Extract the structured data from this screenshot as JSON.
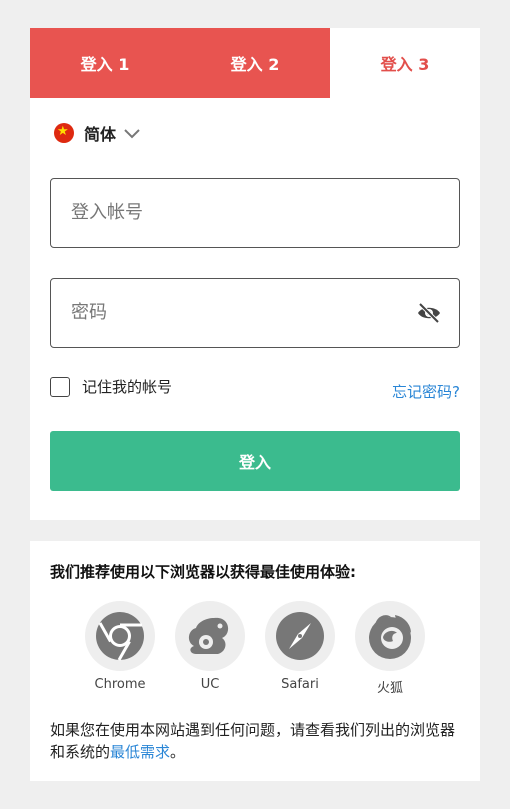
{
  "tabs": [
    {
      "label": "登入 1"
    },
    {
      "label": "登入 2"
    },
    {
      "label": "登入 3"
    }
  ],
  "language": {
    "flag_icon": "china-flag-icon",
    "label": "简体"
  },
  "account": {
    "placeholder": "登入帐号"
  },
  "password": {
    "placeholder": "密码"
  },
  "remember": {
    "label": "记住我的帐号"
  },
  "forgot": {
    "label": "忘记密码?"
  },
  "login_button": {
    "label": "登入"
  },
  "recommendation": {
    "title": "我们推荐使用以下浏览器以获得最佳使用体验:",
    "browsers": [
      {
        "name": "Chrome",
        "icon": "chrome-icon"
      },
      {
        "name": "UC",
        "icon": "uc-browser-icon"
      },
      {
        "name": "Safari",
        "icon": "safari-icon"
      },
      {
        "name": "火狐",
        "icon": "firefox-icon"
      }
    ],
    "help_text": "如果您在使用本网站遇到任何问题，请查看我们列出的浏览器和系统的",
    "help_link": "最低需求",
    "help_end": "。"
  },
  "colors": {
    "tab_red": "#e85450",
    "accent_red": "#e24f4b",
    "login_green": "#3bbb8e",
    "link_blue": "#2a86d6",
    "background": "#efefef"
  }
}
